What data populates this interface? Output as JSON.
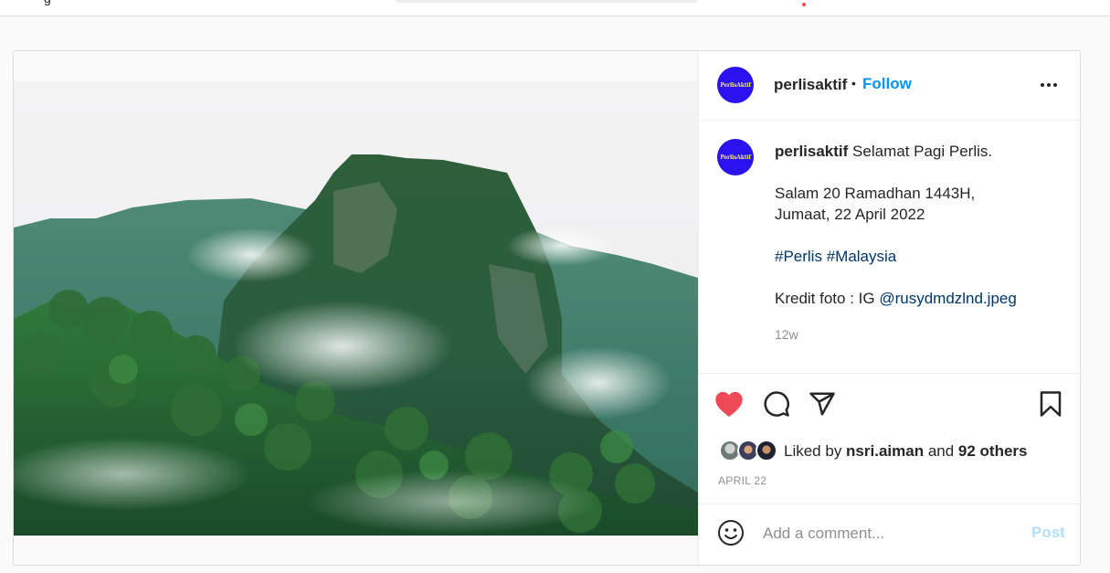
{
  "topbar": {
    "nav_fragment": "g"
  },
  "post": {
    "author": "perlisaktif",
    "avatar_text": "PerlisAktif",
    "follow_label": "Follow",
    "separator": "•",
    "caption_user": "perlisaktif",
    "caption_lines": [
      "Selamat Pagi Perlis.",
      "",
      "Salam 20 Ramadhan 1443H,",
      "Jumaat, 22 April 2022",
      "",
      "#Perlis #Malaysia",
      "",
      "Kredit foto : IG @rusydmdzlnd.jpeg"
    ],
    "hashtags": [
      "#Perlis",
      "#Malaysia"
    ],
    "credit_prefix": "Kredit foto : IG ",
    "credit_handle": "@rusydmdzlnd.jpeg",
    "time_ago": "12w",
    "liked_by_prefix": "Liked by ",
    "liked_by_user": "nsri.aiman",
    "liked_by_and": " and ",
    "liked_by_others": "92 others",
    "date": "APRIL 22",
    "liked": true
  },
  "comment": {
    "placeholder": "Add a comment...",
    "post_label": "Post"
  },
  "colors": {
    "accent": "#0095f6",
    "like": "#ed4956",
    "avatar_bg": "#2a13ee",
    "hashtag": "#00376b",
    "post_disabled": "#b2dffc"
  },
  "icons": [
    "more-icon",
    "heart-icon",
    "comment-icon",
    "share-icon",
    "bookmark-icon",
    "emoji-icon"
  ]
}
